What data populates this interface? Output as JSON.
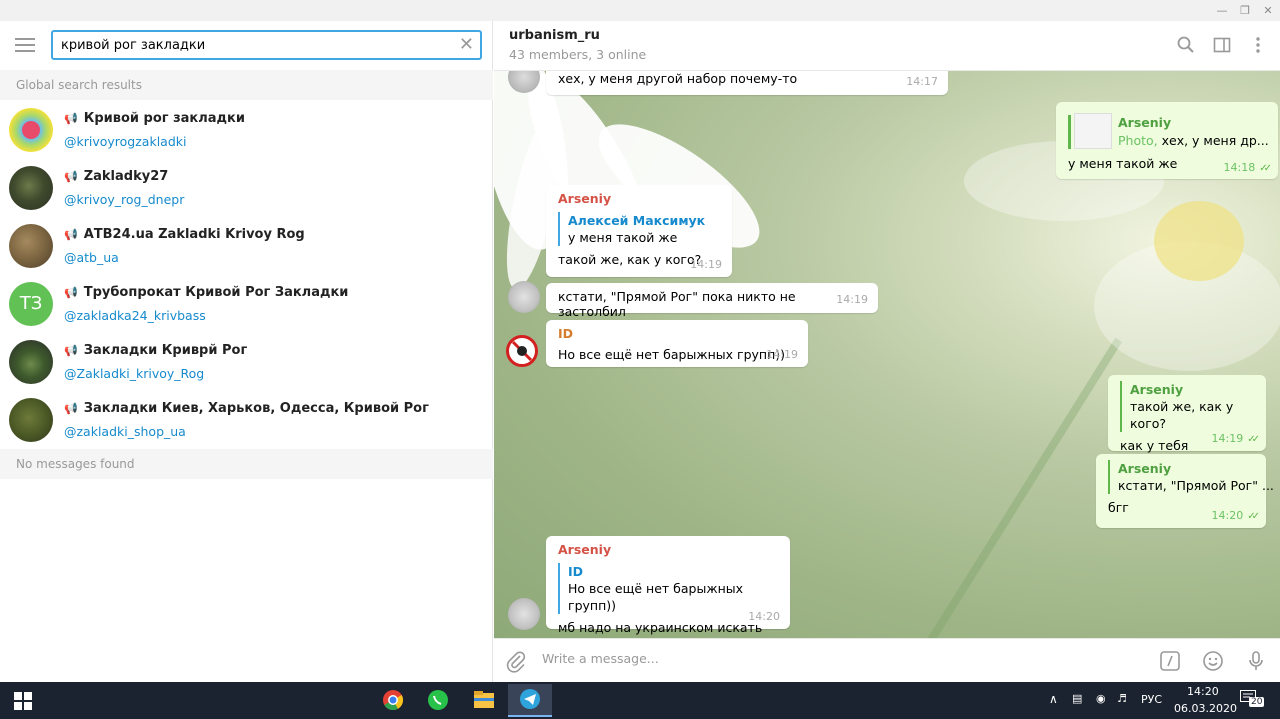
{
  "search": {
    "value": "кривой рог закладки"
  },
  "sections": {
    "global": "Global search results",
    "messages": "No messages found"
  },
  "results": [
    {
      "title": "Кривой рог закладки",
      "username": "@krivoyrogzakladki",
      "avatar": "colorful-lips"
    },
    {
      "title": "Zakladky27",
      "username": "@krivoy_rog_dnepr",
      "avatar": "green-pack"
    },
    {
      "title": "АТВ24.ua Zakladki Krivoy Rog",
      "username": "@atb_ua",
      "avatar": "brown-texture"
    },
    {
      "title": "Трубопрокат Кривой Рог Закладки",
      "username": "@zakladka24_krivbass",
      "avatar": "initials",
      "initials": "ТЗ"
    },
    {
      "title": "Закладки Кривpй Рог",
      "username": "@Zakladki_krivoy_Rog",
      "avatar": "cannabis"
    },
    {
      "title": "Закладки Киев, Харьков, Одесса, Кривой Рог",
      "username": "@zakladki_shop_ua",
      "avatar": "green-bud"
    }
  ],
  "chat": {
    "title": "urbanism_ru",
    "subtitle": "43 members, 3 online"
  },
  "messages": [
    {
      "dir": "in",
      "text": "хех, у меня другой набор почему-то",
      "time": "14:17"
    },
    {
      "dir": "out",
      "reply_name": "Arseniy",
      "reply_prefix": "Photo,",
      "reply_text": "хех, у меня др...",
      "text": "у меня такой же",
      "time": "14:18"
    },
    {
      "dir": "in",
      "sender": "Arseniy",
      "reply_name": "Алексей Максимук",
      "reply_text": "у меня такой же",
      "text": "такой же, как у кого?",
      "time": "14:19"
    },
    {
      "dir": "in",
      "text": "кстати, \"Прямой Рог\" пока никто не застолбил",
      "time": "14:19"
    },
    {
      "dir": "in",
      "sender": "ID",
      "text": "Но все ещё нет барыжных групп))",
      "time": "14:19"
    },
    {
      "dir": "out",
      "reply_name": "Arseniy",
      "reply_text": "такой же, как у кого?",
      "text": "как у тебя",
      "time": "14:19"
    },
    {
      "dir": "out",
      "reply_name": "Arseniy",
      "reply_text": "кстати, \"Прямой Рог\" ...",
      "text": "бгг",
      "time": "14:20"
    },
    {
      "dir": "in",
      "sender": "Arseniy",
      "reply_name": "ID",
      "reply_text": "Но все ещё нет барыжных групп))",
      "text": "мб надо на украинском искать",
      "time": "14:20"
    }
  ],
  "composer": {
    "placeholder": "Write a message..."
  },
  "taskbar": {
    "lang": "РУС",
    "time": "14:20",
    "date": "06.03.2020",
    "notifications": "20"
  },
  "colors": {
    "accent": "#40a7e3",
    "link": "#168acd",
    "out_bubble": "#effdde",
    "sender_red": "#d45246",
    "sender_orange": "#d57c2c"
  }
}
